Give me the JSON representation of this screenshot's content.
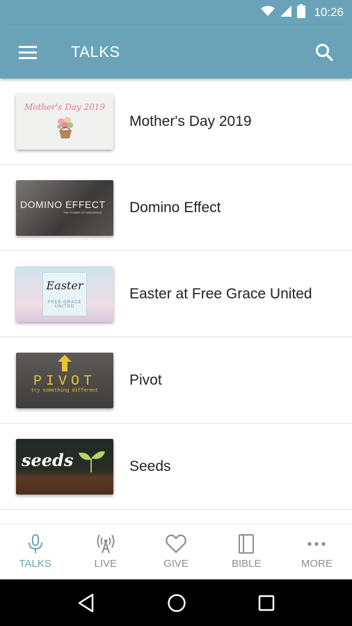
{
  "status_bar": {
    "time": "10:26"
  },
  "app_bar": {
    "title": "TALKS"
  },
  "talks": [
    {
      "title": "Mother's Day 2019",
      "thumb_text": "Mother's Day 2019"
    },
    {
      "title": "Domino Effect",
      "thumb_text": "DOMINO EFFECT",
      "thumb_sub": "THE POWER OF OBEDIENCE"
    },
    {
      "title": "Easter at Free Grace United",
      "thumb_text": "Easter",
      "thumb_sub": "FREE GRACE UNITED"
    },
    {
      "title": "Pivot",
      "thumb_text": "PIVOT",
      "thumb_sub": "try something different"
    },
    {
      "title": "Seeds",
      "thumb_text": "seeds"
    }
  ],
  "bottom_nav": [
    {
      "label": "TALKS",
      "icon": "microphone-icon",
      "active": true
    },
    {
      "label": "LIVE",
      "icon": "broadcast-icon",
      "active": false
    },
    {
      "label": "GIVE",
      "icon": "heart-icon",
      "active": false
    },
    {
      "label": "BIBLE",
      "icon": "book-icon",
      "active": false
    },
    {
      "label": "MORE",
      "icon": "more-dots-icon",
      "active": false
    }
  ],
  "colors": {
    "primary": "#6aa3b8",
    "inactive": "#8e8e8e",
    "text": "#222222"
  }
}
